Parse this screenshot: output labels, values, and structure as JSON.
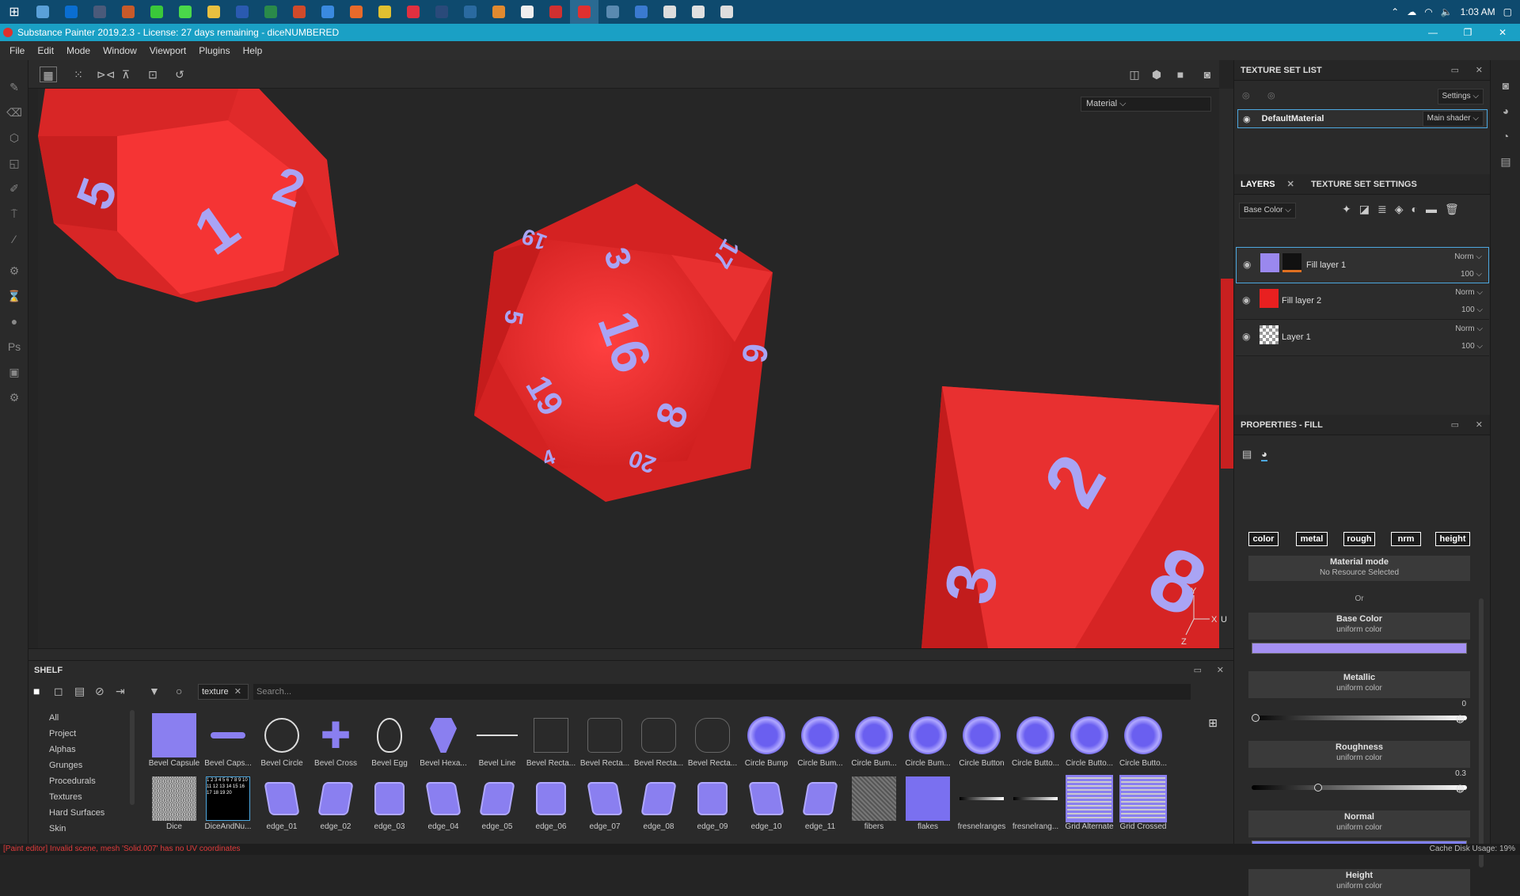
{
  "taskbar": {
    "time": "1:03 AM",
    "apps": [
      {
        "name": "photos",
        "color": "#5aa0d8"
      },
      {
        "name": "outlook",
        "color": "#0a6ed1"
      },
      {
        "name": "calculator",
        "color": "#4a5a7a"
      },
      {
        "name": "app-dark",
        "color": "#c85a2a"
      },
      {
        "name": "app-green",
        "color": "#3ac83a"
      },
      {
        "name": "app-cloud",
        "color": "#4ad84a"
      },
      {
        "name": "explorer",
        "color": "#e8c040"
      },
      {
        "name": "word",
        "color": "#2a5ab0"
      },
      {
        "name": "excel",
        "color": "#2a8a4a"
      },
      {
        "name": "powerpoint",
        "color": "#d04a2a"
      },
      {
        "name": "docs",
        "color": "#3a8ae0"
      },
      {
        "name": "firefox",
        "color": "#e86a2a"
      },
      {
        "name": "chrome",
        "color": "#e0c030"
      },
      {
        "name": "opera",
        "color": "#e03040"
      },
      {
        "name": "lightroom",
        "color": "#2a4a7a"
      },
      {
        "name": "photoshop",
        "color": "#2a6aa0"
      },
      {
        "name": "blender",
        "color": "#e08a30"
      },
      {
        "name": "unity",
        "color": "#eeeeee"
      },
      {
        "name": "substance-designer",
        "color": "#d03030"
      },
      {
        "name": "substance-painter",
        "color": "#e03030"
      },
      {
        "name": "steam",
        "color": "#5a8ab0"
      },
      {
        "name": "app-blue",
        "color": "#3a7ad0"
      },
      {
        "name": "epic",
        "color": "#dddddd"
      },
      {
        "name": "app-round",
        "color": "#e0e0e0"
      },
      {
        "name": "app-vs",
        "color": "#dddddd"
      }
    ]
  },
  "window": {
    "title": "Substance Painter 2019.2.3 - License: 27 days remaining - diceNUMBERED",
    "minimize": "—",
    "maximize": "❐",
    "close": "✕"
  },
  "menu": [
    "File",
    "Edit",
    "Mode",
    "Window",
    "Viewport",
    "Plugins",
    "Help"
  ],
  "viewport": {
    "material_select": "Material ⌵",
    "axes": {
      "y": "Y",
      "x": "X",
      "z": "Z",
      "u": "U"
    }
  },
  "texture_set_list": {
    "title": "TEXTURE SET LIST",
    "settings": "Settings ⌵",
    "material": "DefaultMaterial",
    "shader": "Main shader ⌵"
  },
  "layers": {
    "tab_layers": "LAYERS",
    "tab_settings": "TEXTURE SET SETTINGS",
    "channel": "Base Color ⌵",
    "items": [
      {
        "name": "Fill layer 1",
        "blend": "Norm ⌵",
        "opacity": "100 ⌵",
        "color": "#9a88ee"
      },
      {
        "name": "Fill layer 2",
        "blend": "Norm ⌵",
        "opacity": "100 ⌵",
        "color": "#e82020"
      },
      {
        "name": "Layer 1",
        "blend": "Norm ⌵",
        "opacity": "100 ⌵",
        "color": "#cccccc"
      }
    ]
  },
  "properties": {
    "title": "PROPERTIES - FILL",
    "channels": [
      "color",
      "metal",
      "rough",
      "nrm",
      "height"
    ],
    "material_mode": "Material mode",
    "no_resource": "No Resource Selected",
    "or": "Or",
    "base_color": "Base Color",
    "uniform": "uniform color",
    "base_color_value": "#a490f2",
    "metallic": "Metallic",
    "metallic_value": "0",
    "metallic_fraction": 0,
    "roughness": "Roughness",
    "roughness_value": "0.3",
    "roughness_fraction": 0.3,
    "normal": "Normal",
    "normal_value": "#8080f4",
    "height": "Height"
  },
  "shelf": {
    "title": "SHELF",
    "filter_tag": "texture",
    "search_placeholder": "Search...",
    "categories": [
      "All",
      "Project",
      "Alphas",
      "Grunges",
      "Procedurals",
      "Textures",
      "Hard Surfaces",
      "Skin"
    ],
    "row1": [
      "Bevel Capsule",
      "Bevel Caps...",
      "Bevel Circle",
      "Bevel Cross",
      "Bevel Egg",
      "Bevel Hexa...",
      "Bevel Line",
      "Bevel Recta...",
      "Bevel Recta...",
      "Bevel Recta...",
      "Bevel Recta...",
      "Circle Bump",
      "Circle Bum...",
      "Circle Bum...",
      "Circle Bum...",
      "Circle Button",
      "Circle Butto...",
      "Circle Butto...",
      "Circle Butto..."
    ],
    "row2": [
      "Dice",
      "DiceAndNu...",
      "edge_01",
      "edge_02",
      "edge_03",
      "edge_04",
      "edge_05",
      "edge_06",
      "edge_07",
      "edge_08",
      "edge_09",
      "edge_10",
      "edge_11",
      "fibers",
      "flakes",
      "fresnelranges",
      "fresnelrang...",
      "Grid Alternate",
      "Grid Crossed"
    ]
  },
  "status": {
    "error": "[Paint editor] Invalid scene, mesh 'Solid.007' has no UV coordinates",
    "cache": "Cache Disk Usage:   19%"
  },
  "dice_numbers": {
    "d12": [
      "5",
      "1",
      "2"
    ],
    "d20": [
      "19",
      "3",
      "17",
      "5",
      "16",
      "6",
      "19",
      "8",
      "4",
      "20"
    ],
    "d8": [
      "2",
      "3",
      "8"
    ]
  }
}
